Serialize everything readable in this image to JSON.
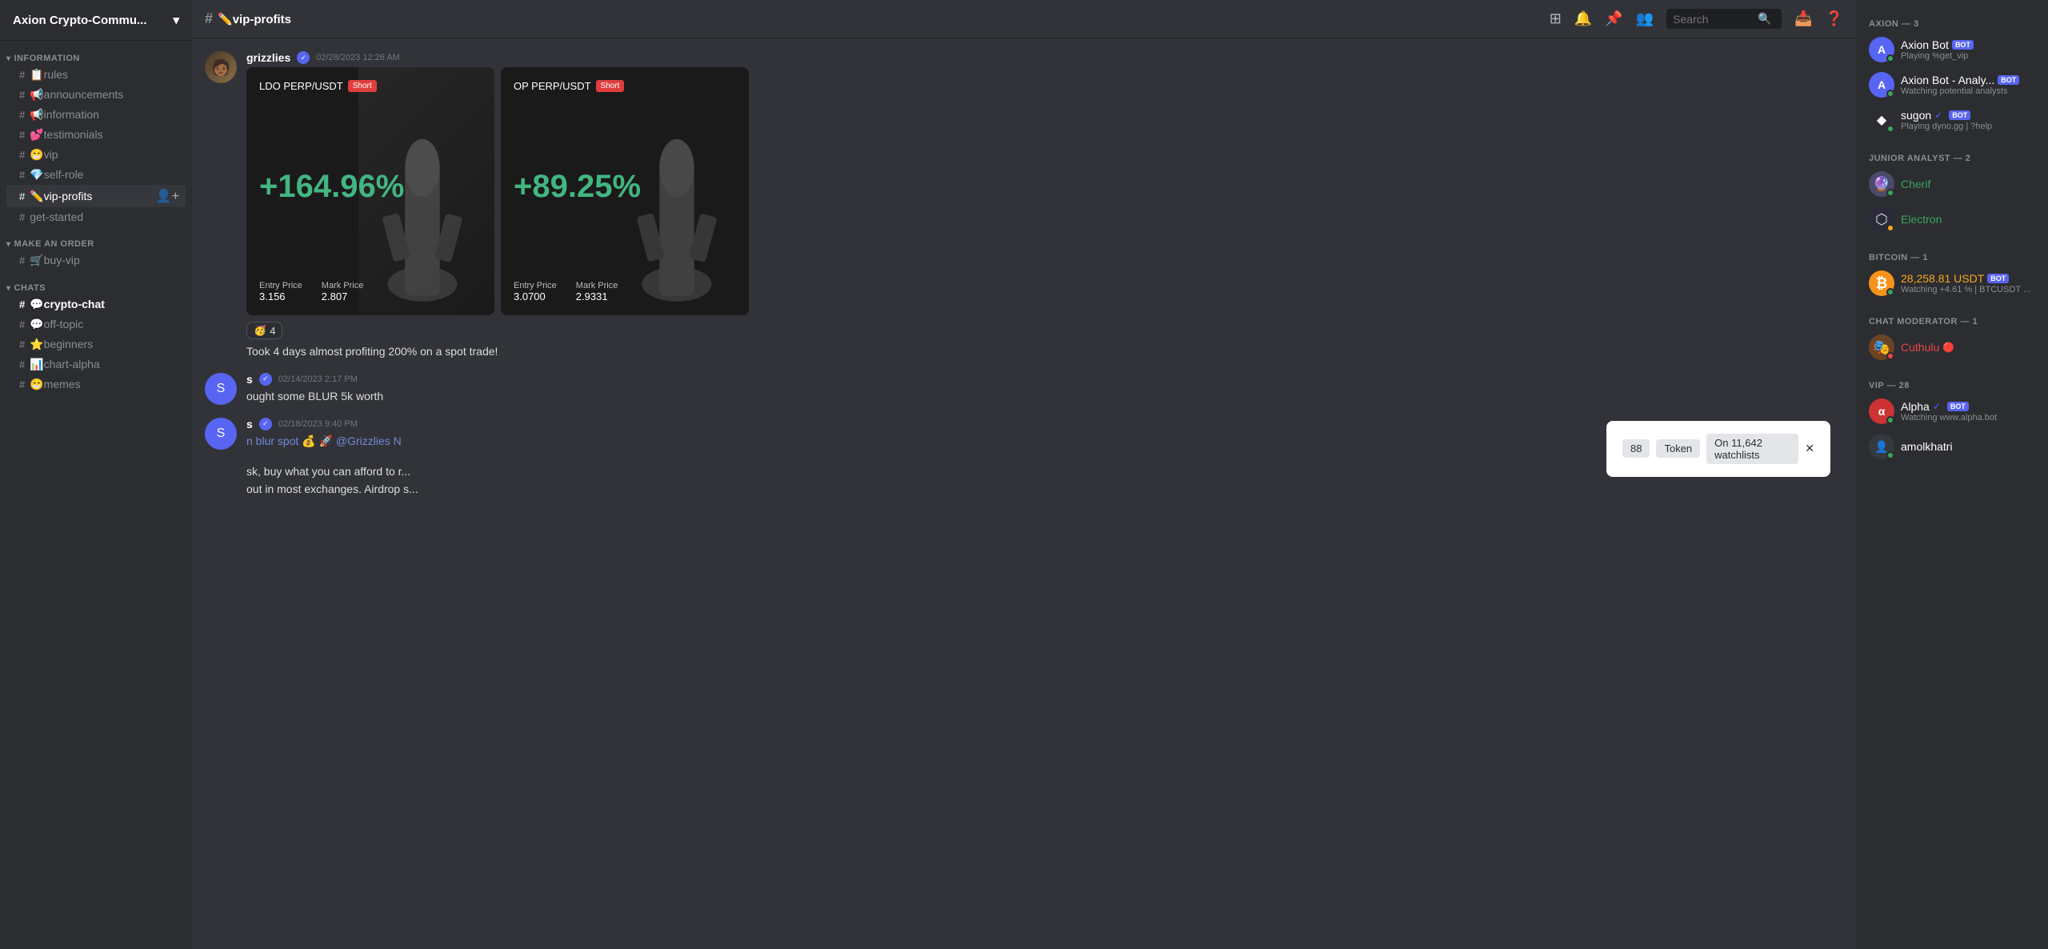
{
  "server": {
    "name": "Axion Crypto-Commu...",
    "icon": "🪙"
  },
  "header": {
    "channel_hash": "#",
    "channel_name": "✏️vip-profits",
    "search_placeholder": "Search"
  },
  "sidebar": {
    "categories": [
      {
        "name": "INFORMATION",
        "channels": [
          {
            "icon": "📋",
            "name": "rules",
            "type": "text"
          },
          {
            "icon": "📢",
            "name": "📢announcements",
            "type": "text"
          },
          {
            "icon": "📢",
            "name": "📢information",
            "type": "text"
          },
          {
            "icon": "💕",
            "name": "💕testimonials",
            "type": "text"
          },
          {
            "icon": "😁",
            "name": "😁vip",
            "type": "text"
          },
          {
            "icon": "💎",
            "name": "💎self-role",
            "type": "text"
          },
          {
            "icon": "✏️",
            "name": "✏️vip-profits",
            "type": "text",
            "active": true
          },
          {
            "icon": "#",
            "name": "get-started",
            "type": "text"
          }
        ]
      },
      {
        "name": "MAKE AN ORDER",
        "channels": [
          {
            "icon": "🛒",
            "name": "🛒buy-vip",
            "type": "text"
          }
        ]
      },
      {
        "name": "CHATS",
        "channels": [
          {
            "icon": "💬",
            "name": "💬crypto-chat",
            "type": "text"
          },
          {
            "icon": "💬",
            "name": "💬off-topic",
            "type": "text"
          },
          {
            "icon": "⭐",
            "name": "⭐beginners",
            "type": "text"
          },
          {
            "icon": "📊",
            "name": "📊chart-alpha",
            "type": "text"
          },
          {
            "icon": "😁",
            "name": "😁memes",
            "type": "text"
          }
        ]
      }
    ]
  },
  "messages": [
    {
      "username": "grizzlies",
      "verified": true,
      "timestamp": "02/28/2023 12:26 AM",
      "reaction": {
        "emoji": "🥳",
        "count": "4"
      },
      "caption": "Took 4 days almost profiting 200% on a spot trade!",
      "trades": [
        {
          "pair": "LDO PERP/USDT",
          "direction": "Short",
          "pct": "+164.96%",
          "entry_label": "Entry Price",
          "entry_val": "3.156",
          "mark_label": "Mark Price",
          "mark_val": "2.807"
        },
        {
          "pair": "OP PERP/USDT",
          "direction": "Short",
          "pct": "+89.25%",
          "entry_label": "Entry Price",
          "entry_val": "3.0700",
          "mark_label": "Mark Price",
          "mark_val": "2.9331"
        }
      ]
    },
    {
      "username": "s",
      "verified": true,
      "timestamp": "02/14/2023 2:17 PM",
      "text": "ought some BLUR 5k worth"
    },
    {
      "username": "s",
      "verified": true,
      "timestamp": "02/18/2023 9:40 PM",
      "text": "n blur spot 💰 🚀 @Grizzlies N"
    }
  ],
  "popup": {
    "token_label": "Token",
    "watchlist_label": "On 11,642 watchlists",
    "watchlist_count": "88"
  },
  "members": {
    "sections": [
      {
        "label": "AXION — 3",
        "members": [
          {
            "name": "Axion Bot",
            "bot": true,
            "status": "Playing %get_vip",
            "color": "white",
            "status_dot": "online",
            "icon": "🅰️"
          },
          {
            "name": "Axion Bot - Analy...",
            "bot": true,
            "status": "Watching potential analysts",
            "color": "white",
            "status_dot": "online",
            "icon": "🅰️"
          },
          {
            "name": "sugon",
            "bot": true,
            "check": true,
            "status": "Playing dyno.gg | ?help",
            "color": "white",
            "status_dot": "online",
            "icon": "◆"
          }
        ]
      },
      {
        "label": "JUNIOR ANALYST — 2",
        "members": [
          {
            "name": "Cherif",
            "status": "",
            "color": "green",
            "status_dot": "online",
            "icon": "🔮"
          },
          {
            "name": "Electron",
            "status": "",
            "color": "green",
            "status_dot": "idle",
            "icon": "⬡"
          }
        ]
      },
      {
        "label": "BITCOIN — 1",
        "members": [
          {
            "name": "28,258.81 USDT",
            "bot": true,
            "status": "Watching +4.61 % | BTCUSDT ...",
            "color": "orange",
            "status_dot": "online",
            "icon": "₿"
          }
        ]
      },
      {
        "label": "CHAT MODERATOR — 1",
        "members": [
          {
            "name": "Cuthulu",
            "dnd": true,
            "status": "",
            "color": "red",
            "status_dot": "dnd",
            "icon": "🎭"
          }
        ]
      },
      {
        "label": "VIP — 28",
        "members": [
          {
            "name": "Alpha",
            "bot": true,
            "check": true,
            "status": "Watching www.alpha.bot",
            "color": "white",
            "status_dot": "online",
            "icon": "🔴"
          },
          {
            "name": "amolkhatri",
            "status": "",
            "color": "white",
            "status_dot": "online",
            "icon": "👤"
          }
        ]
      }
    ]
  },
  "toolbar_icons": {
    "hash": "#",
    "bell": "🔔",
    "pin": "📌",
    "members": "👥",
    "search": "🔍",
    "inbox": "📥",
    "help": "❓"
  }
}
